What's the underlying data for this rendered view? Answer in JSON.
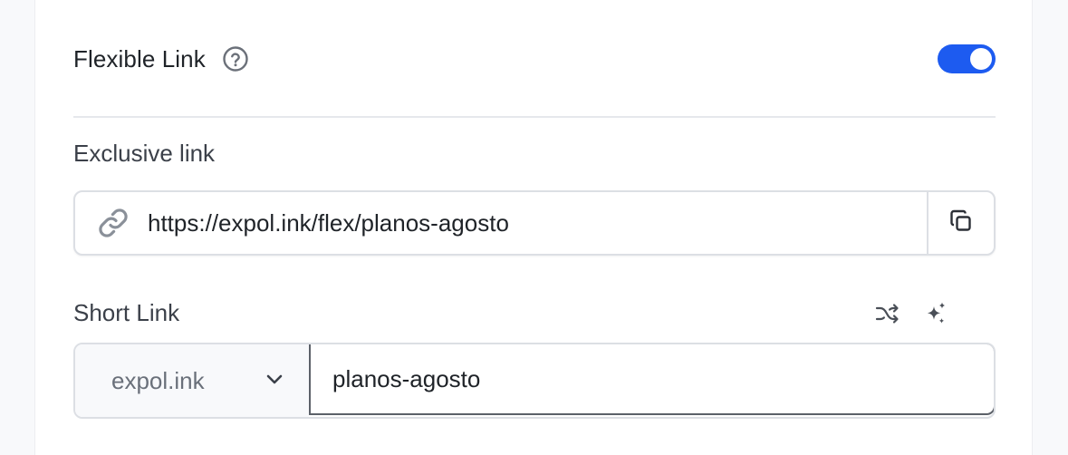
{
  "flexible": {
    "title": "Flexible Link",
    "help_icon": "question-circle-icon",
    "toggle_on": true,
    "accent": "#1d5bf0"
  },
  "exclusive": {
    "label": "Exclusive link",
    "url": "https://expol.ink/flex/planos-agosto",
    "link_icon": "link-icon",
    "copy_icon": "copy-icon"
  },
  "short": {
    "label": "Short Link",
    "shuffle_icon": "shuffle-icon",
    "sparkle_icon": "sparkles-icon",
    "domain": "expol.ink",
    "slug": "planos-agosto"
  }
}
